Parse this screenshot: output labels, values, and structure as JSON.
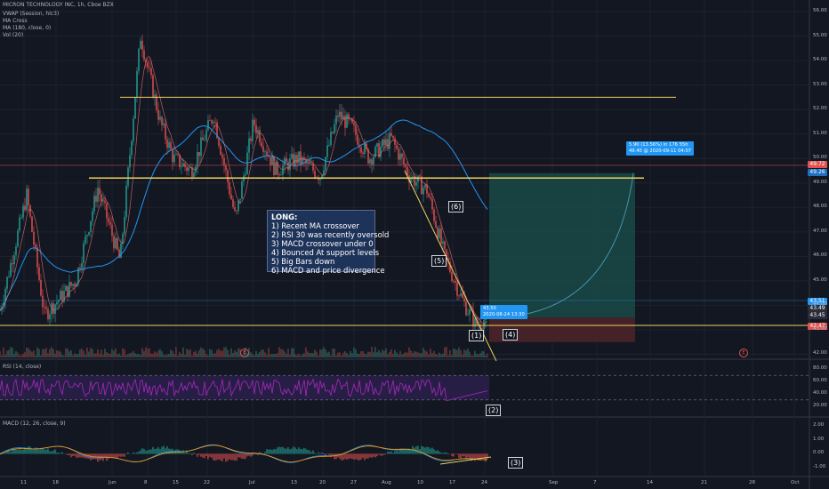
{
  "legend": {
    "symbol": "MICRON TECHNOLOGY INC, 1h, Cboe BZX",
    "vwap": "VWAP (Session, hlc3)",
    "ma_cross": "MA Cross",
    "ma": "MA (180, close, 0)",
    "vol": "Vol (20)",
    "rsi": "RSI (14, close)",
    "macd": "MACD (12, 26, close, 9)"
  },
  "note": {
    "title": "LONG:",
    "lines": [
      "1) Recent MA crossover",
      "2) RSI 30 was recently oversold",
      "3) MACD crossover under 0",
      "4) Bounced At support levels",
      "5) Big Bars down",
      "6) MACD and price divergence"
    ]
  },
  "labels": {
    "l1": "(1)",
    "l2": "(2)",
    "l3": "(3)",
    "l4": "(4)",
    "l5": "(5)",
    "l6": "(6)"
  },
  "tooltips": {
    "target_1": "5.90 (13.56%) in 176 55h",
    "target_2": "49.40 @ 2020-09-11 04:07",
    "entry_1": "43.50",
    "entry_2": "2020-08-24 13:30"
  },
  "price_tags": {
    "target": "49.72",
    "ma": "49.26",
    "last": "43.51",
    "vwap": "43.49",
    "low": "43.45",
    "stop": "42.47"
  },
  "colors": {
    "background": "#131722",
    "up": "#26a69a",
    "down": "#ef5350",
    "support_line": "#f0d060",
    "ma_line": "#2196f3",
    "rsi_line": "#9c27b0",
    "target_zone": "#1a4a47",
    "stop_zone": "#4a2428"
  },
  "price_axis": [
    "56.00",
    "55.00",
    "54.00",
    "53.00",
    "52.00",
    "51.00",
    "50.00",
    "49.00",
    "48.00",
    "47.00",
    "46.00",
    "45.00",
    "44.00",
    "43.00",
    "42.00"
  ],
  "rsi_axis": [
    "80.00",
    "60.00",
    "40.00",
    "20.00"
  ],
  "macd_axis": [
    "2.00",
    "1.00",
    "0.00",
    "-1.00"
  ],
  "time_axis": [
    "11",
    "18",
    "Jun",
    "8",
    "15",
    "22",
    "Jul",
    "13",
    "20",
    "27",
    "Aug",
    "10",
    "17",
    "24",
    "Sep",
    "7",
    "14",
    "21",
    "28",
    "Oct"
  ],
  "chart_data": {
    "type": "candlestick",
    "title": "MICRON TECHNOLOGY INC, 1h, Cboe BZX",
    "ylim": [
      41.8,
      56.4
    ],
    "anchors": [
      [
        0,
        43.8
      ],
      [
        30,
        48.5
      ],
      [
        50,
        43.6
      ],
      [
        85,
        45.0
      ],
      [
        110,
        48.8
      ],
      [
        135,
        45.8
      ],
      [
        158,
        55.0
      ],
      [
        180,
        51.5
      ],
      [
        195,
        50.0
      ],
      [
        215,
        49.5
      ],
      [
        240,
        51.8
      ],
      [
        265,
        47.5
      ],
      [
        285,
        51.5
      ],
      [
        310,
        49.5
      ],
      [
        335,
        50.0
      ],
      [
        360,
        49.3
      ],
      [
        380,
        51.8
      ],
      [
        395,
        51.3
      ],
      [
        415,
        50.0
      ],
      [
        440,
        50.8
      ],
      [
        460,
        49.3
      ],
      [
        480,
        48.7
      ],
      [
        500,
        46.0
      ],
      [
        520,
        44.2
      ],
      [
        535,
        43.2
      ],
      [
        548,
        43.5
      ]
    ],
    "support_levels": [
      52.5,
      49.2,
      42.4
    ],
    "trade": {
      "entry": 43.5,
      "target": 49.4,
      "stop": 42.5
    },
    "rsi_range": [
      20,
      80
    ]
  }
}
